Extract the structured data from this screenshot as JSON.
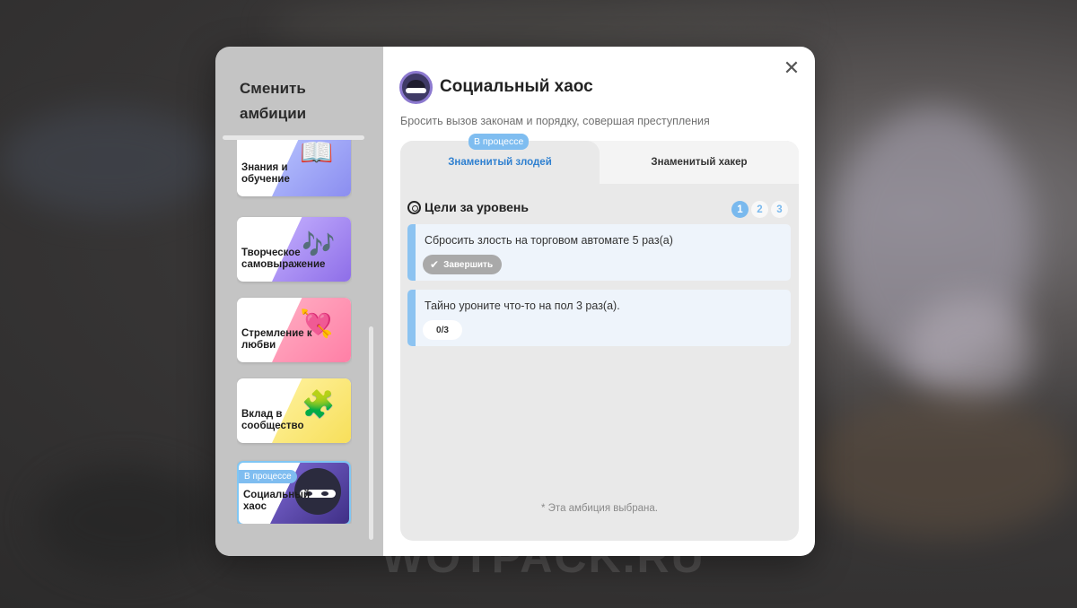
{
  "watermark": "WOTPACK.RU",
  "sidebar": {
    "title": "Сменить амбиции",
    "items": [
      {
        "label": "Знания и обучение"
      },
      {
        "label": "Творческое самовыражение"
      },
      {
        "label": "Стремление к любви"
      },
      {
        "label": "Вклад в сообщество"
      },
      {
        "label": "Социальный хаос",
        "badge": "В процессе",
        "selected": true
      }
    ]
  },
  "main": {
    "title": "Социальный хаос",
    "subtitle": "Бросить вызов законам и порядку, совершая преступления",
    "close_icon": "close-icon",
    "tabs": [
      {
        "label": "Знаменитый злодей",
        "badge": "В процессе",
        "active": true
      },
      {
        "label": "Знаменитый хакер",
        "active": false
      }
    ],
    "goals": {
      "title": "Цели за уровень",
      "levels": [
        "1",
        "2",
        "3"
      ],
      "current_level": "1"
    },
    "tasks": [
      {
        "text": "Сбросить злость на торговом автомате 5 раз(а)",
        "action": "Завершить"
      },
      {
        "text": "Тайно уроните что-то на пол 3 раз(а).",
        "progress": "0/3"
      }
    ],
    "note": "* Эта амбиция выбрана."
  },
  "colors": {
    "accent": "#7fbdf0",
    "tab_active_text": "#2f80d0",
    "task_bar": "#8cc3f1"
  }
}
